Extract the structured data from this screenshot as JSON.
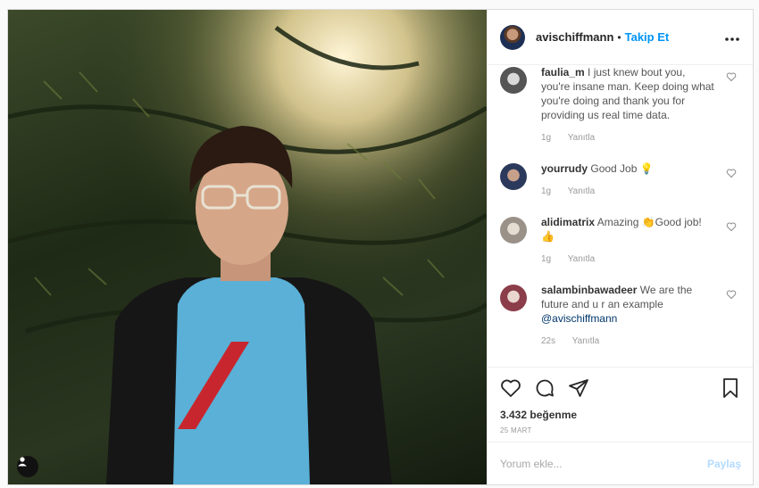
{
  "post": {
    "author": {
      "username": "avischiffmann",
      "follow_label": "Takip Et",
      "separator": "•"
    },
    "more_label": "•••",
    "comments": [
      {
        "username": "faulia_m",
        "text": "I just knew bout you, you're insane man. Keep doing what you're doing and thank you for providing us real time data.",
        "time": "1g",
        "reply_label": "Yanıtla",
        "avatar_color": "#8a8a8a"
      },
      {
        "username": "yourrudy",
        "text": "Good Job 💡",
        "time": "1g",
        "reply_label": "Yanıtla",
        "avatar_color": "#4a5a7a"
      },
      {
        "username": "alidimatrix",
        "text": "Amazing 👏Good job! 👍",
        "time": "1g",
        "reply_label": "Yanıtla",
        "avatar_color": "#b9b2a6"
      },
      {
        "username": "salambinbawadeer",
        "text": "We are the future and u r an example",
        "mention": "@avischiffmann",
        "time": "22s",
        "reply_label": "Yanıtla",
        "avatar_color": "#9b4e5a"
      }
    ],
    "likes": "3.432 beğenme",
    "date": "25 MART",
    "comment_input": {
      "placeholder": "Yorum ekle...",
      "value": ""
    },
    "share_label": "Paylaş"
  },
  "colors": {
    "accent": "#0095f6",
    "share_disabled": "#b3dbff"
  },
  "icons": [
    "user-tag-icon",
    "heart-icon",
    "comment-icon",
    "share-icon",
    "bookmark-icon",
    "more-icon"
  ]
}
